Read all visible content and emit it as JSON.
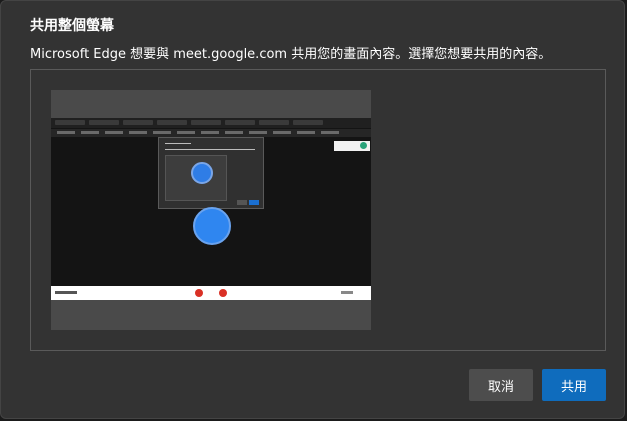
{
  "dialog": {
    "title": "共用整個螢幕",
    "description": "Microsoft Edge 想要與 meet.google.com 共用您的畫面內容。選擇您想要共用的內容。"
  },
  "buttons": {
    "cancel_label": "取消",
    "share_label": "共用"
  },
  "colors": {
    "dialog_bg": "#333333",
    "share_button": "#0f6cbd",
    "cancel_button": "#4d4d4d",
    "preview_accent": "#2f86f0"
  }
}
